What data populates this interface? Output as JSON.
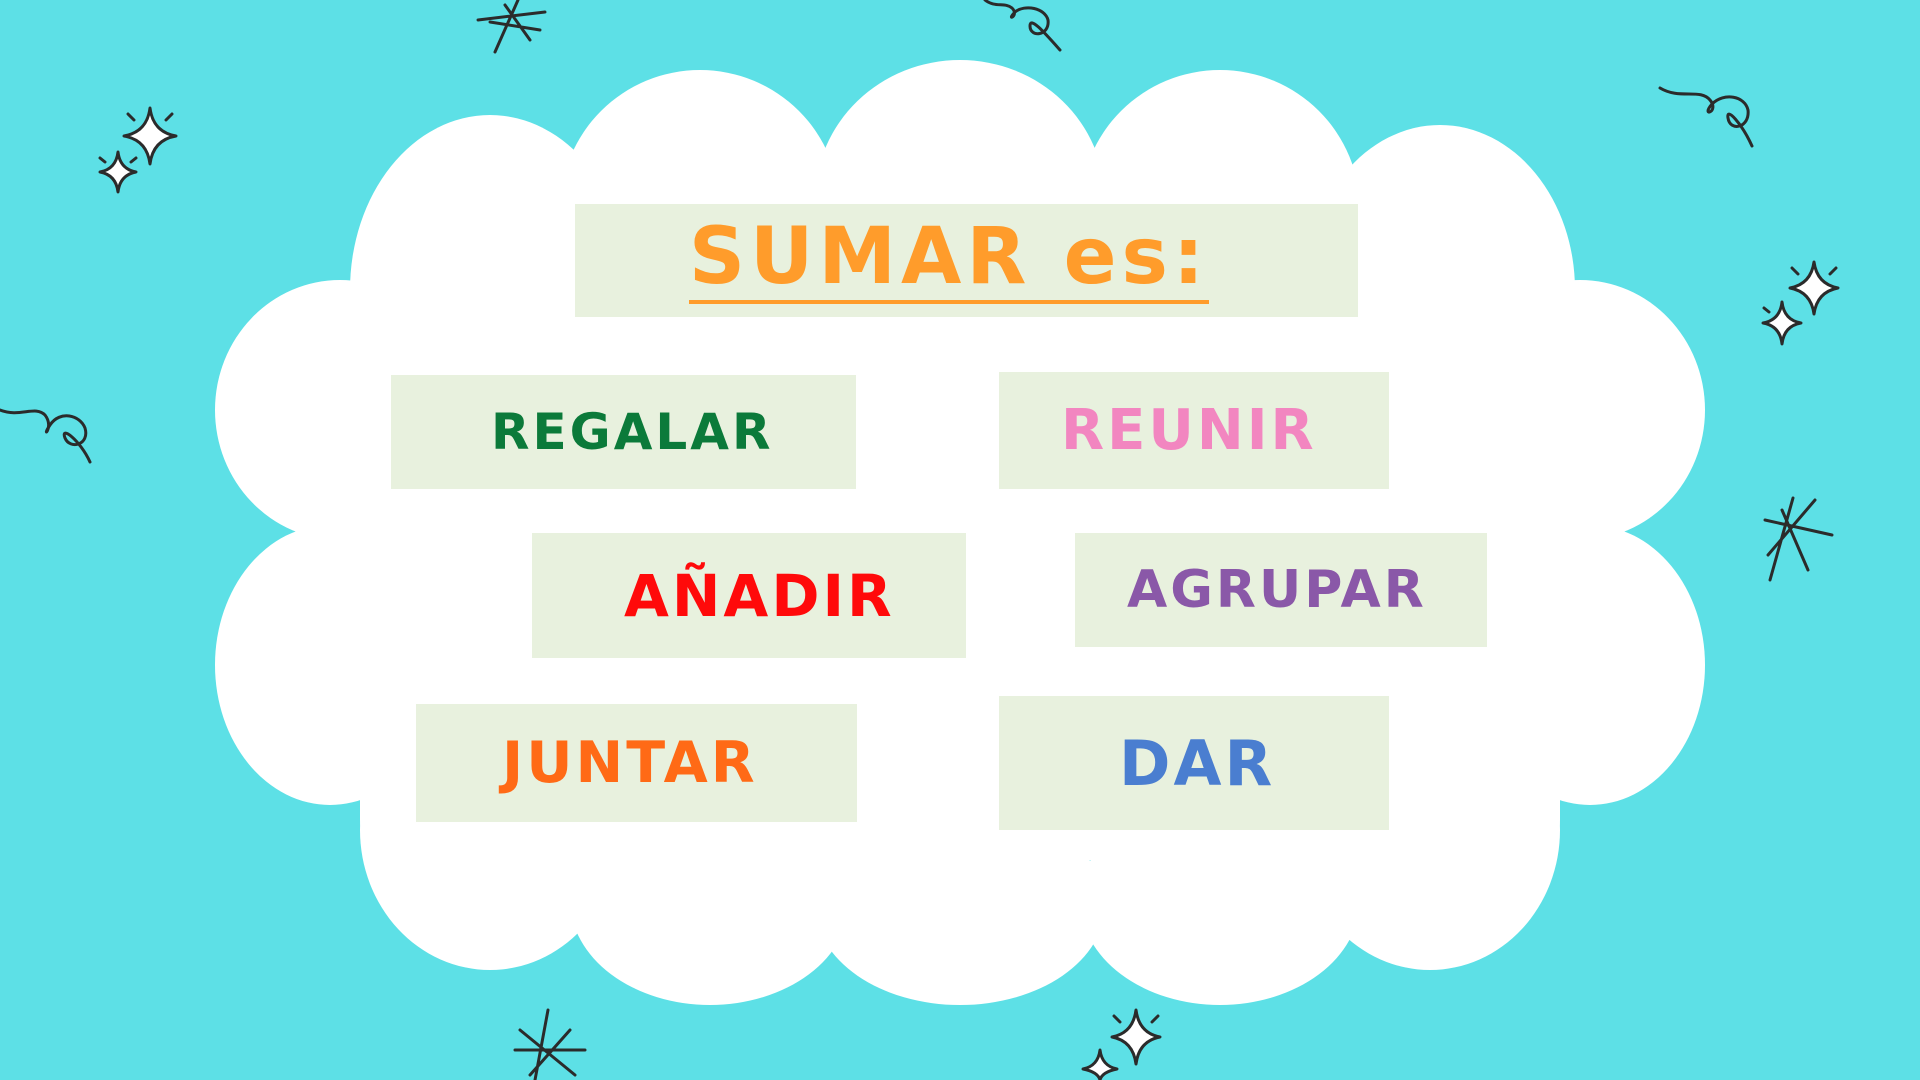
{
  "title": "SUMAR es:",
  "colors": {
    "background": "#5DE0E6",
    "cloud": "#FFFFFF",
    "box": "#E8F1DE",
    "title": "#FF9C2B",
    "doodle": "#2B2B2B"
  },
  "words": [
    {
      "text": "REGALAR",
      "color": "#0B7A3A"
    },
    {
      "text": "REUNIR",
      "color": "#F286C0"
    },
    {
      "text": "AÑADIR",
      "color": "#FF0A0A"
    },
    {
      "text": "AGRUPAR",
      "color": "#8A58A8"
    },
    {
      "text": "JUNTAR",
      "color": "#FF6A16"
    },
    {
      "text": "DAR",
      "color": "#4A7ED0"
    }
  ],
  "decorations": {
    "icons": [
      "sparkle-icon",
      "curl-doodle-icon",
      "asterisk-doodle-icon"
    ]
  }
}
